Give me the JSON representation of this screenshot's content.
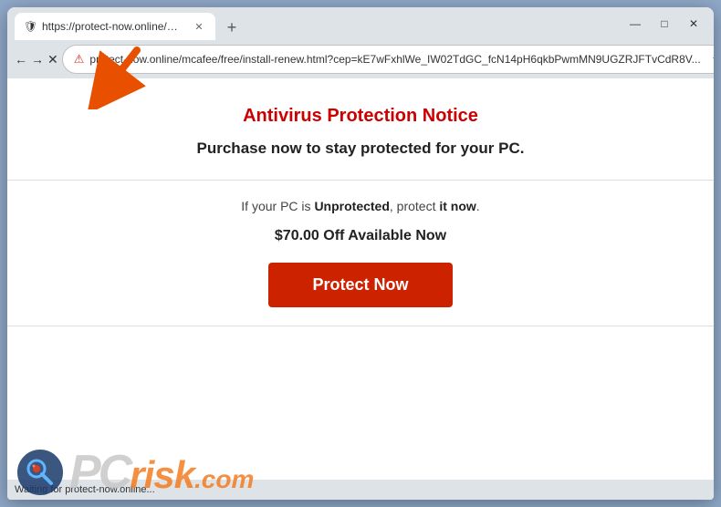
{
  "browser": {
    "tab": {
      "title": "https://protect-now.online/mca…",
      "favicon": "🛡"
    },
    "new_tab_label": "+",
    "window_controls": {
      "minimize": "—",
      "maximize": "□",
      "close": "✕"
    },
    "nav": {
      "back": "←",
      "forward": "→",
      "reload": "✕",
      "address": "protect-now.online/mcafee/free/install-renew.html?cep=kE7wFxhlWe_IW02TdGC_fcN14pH6qkbPwmMN9UGZRJFTvCdR8V...",
      "bookmark": "☆",
      "profile": "👤",
      "menu": "⋮"
    }
  },
  "page": {
    "notice_header": "Antivirus Protection Notice",
    "notice_subheader": "Purchase now to stay protected for your PC.",
    "body_text": "If your PC is ",
    "body_bold": "Unprotected",
    "body_text2": ", protect ",
    "body_bold2": "it now",
    "body_end": ".",
    "discount": "$70.00 Off Available Now",
    "cta_button": "Protect Now"
  },
  "status_bar": {
    "text": "Waiting for protect-now.online..."
  },
  "watermark": {
    "pc": "PC",
    "risk": "risk",
    "com": ".com"
  }
}
